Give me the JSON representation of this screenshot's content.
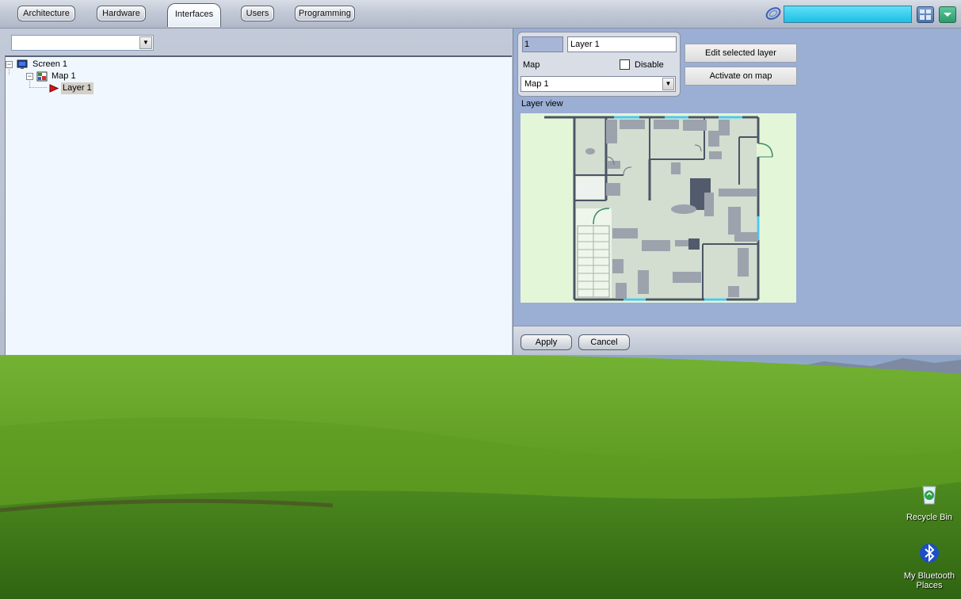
{
  "tabs": [
    {
      "label": "Architecture",
      "active": false
    },
    {
      "label": "Hardware",
      "active": false
    },
    {
      "label": "Interfaces",
      "active": true
    },
    {
      "label": "Users",
      "active": false
    },
    {
      "label": "Programming",
      "active": false
    }
  ],
  "colors": {
    "status_field": "#1cc0e6",
    "panel_blue": "#9baed4",
    "tree_background": "#f0f7fe"
  },
  "tree": {
    "filter_value": "",
    "nodes": [
      {
        "label": "Screen 1",
        "icon": "monitor-icon",
        "level": 0
      },
      {
        "label": "Map 1",
        "icon": "map-icon",
        "level": 1
      },
      {
        "label": "Layer 1",
        "icon": "layer-icon",
        "level": 2,
        "selected": true
      }
    ]
  },
  "properties": {
    "layer_id": "1",
    "layer_name": "Layer 1",
    "map_label": "Map",
    "disable_label": "Disable",
    "disable_checked": false,
    "map_value": "Map 1",
    "edit_button": "Edit selected layer",
    "activate_button": "Activate on map",
    "layer_view_label": "Layer view"
  },
  "actions": {
    "apply": "Apply",
    "cancel": "Cancel"
  },
  "desktop_icons": [
    {
      "label": "Recycle Bin",
      "icon": "recycle-bin-icon"
    },
    {
      "label": "My Bluetooth Places",
      "icon": "bluetooth-icon"
    }
  ]
}
